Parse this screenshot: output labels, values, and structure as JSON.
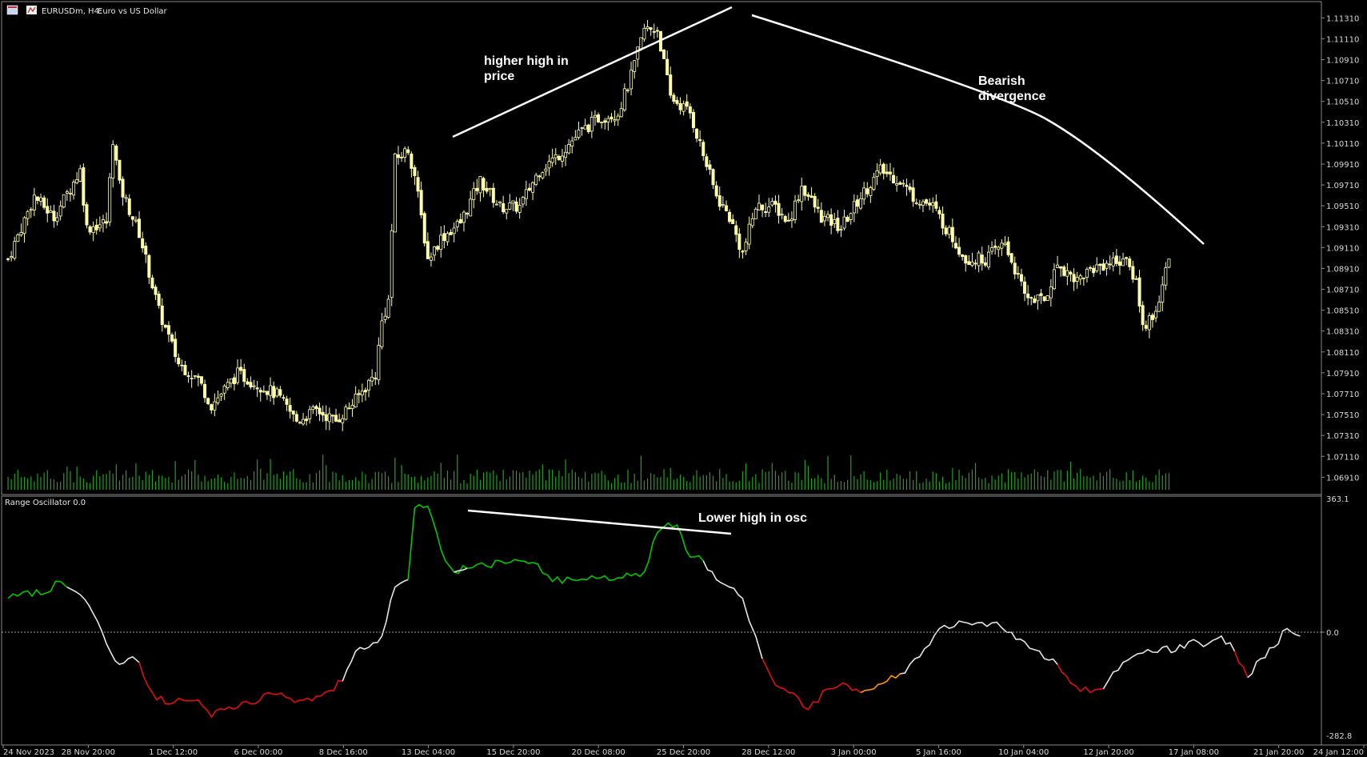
{
  "window": {
    "title_symbol": "EURUSDm, H4:",
    "title_desc": "Euro vs US Dollar",
    "icons": [
      "chart-window-icon",
      "indicator-icon"
    ]
  },
  "indicator": {
    "name": "Range Oscillator 0.0",
    "scale_top": "363.1",
    "scale_zero": "0.0",
    "scale_bottom": "-282.8"
  },
  "annotations": {
    "price_high": [
      "higher high in",
      "price"
    ],
    "bearish": [
      "Bearish",
      "divergence"
    ],
    "osc_high": "Lower high in osc"
  },
  "colors": {
    "background": "#000000",
    "candle": "#ffffaa",
    "volume": "#22a022",
    "osc_green": "#00c800",
    "osc_white": "#e6e6e6",
    "osc_red": "#e01010",
    "osc_orange": "#ff9900",
    "annotation": "#ffffff",
    "axis_text": "#d8d8d8"
  },
  "chart_data": [
    {
      "type": "candlestick",
      "title": "EURUSDm, H4: Euro vs US Dollar",
      "x_tick_labels": [
        "24 Nov 2023",
        "28 Nov 20:00",
        "1 Dec 12:00",
        "6 Dec 00:00",
        "8 Dec 16:00",
        "13 Dec 04:00",
        "15 Dec 20:00",
        "20 Dec 08:00",
        "25 Dec 20:00",
        "28 Dec 12:00",
        "3 Jan 00:00",
        "5 Jan 16:00",
        "10 Jan 04:00",
        "12 Jan 20:00",
        "17 Jan 08:00",
        "21 Jan 20:00",
        "24 Jan 12:00"
      ],
      "y_tick_labels": [
        "1.11310",
        "1.11110",
        "1.10910",
        "1.10710",
        "1.10510",
        "1.10310",
        "1.10110",
        "1.09910",
        "1.09710",
        "1.09510",
        "1.09310",
        "1.09110",
        "1.08910",
        "1.08710",
        "1.08510",
        "1.08310",
        "1.08110",
        "1.07910",
        "1.07710",
        "1.07510",
        "1.07310",
        "1.07110",
        "1.06910"
      ],
      "ylim": [
        1.0679,
        1.1142
      ],
      "close_path": [
        [
          0,
          1.09
        ],
        [
          8,
          1.096
        ],
        [
          14,
          1.094
        ],
        [
          22,
          1.0985
        ],
        [
          24,
          1.093
        ],
        [
          30,
          1.0935
        ],
        [
          32,
          1.1015
        ],
        [
          34,
          1.097
        ],
        [
          40,
          1.0925
        ],
        [
          46,
          1.085
        ],
        [
          52,
          1.08
        ],
        [
          58,
          1.0785
        ],
        [
          62,
          1.076
        ],
        [
          70,
          1.079
        ],
        [
          76,
          1.078
        ],
        [
          82,
          1.077
        ],
        [
          88,
          1.0745
        ],
        [
          94,
          1.0755
        ],
        [
          100,
          1.0745
        ],
        [
          106,
          1.0765
        ],
        [
          112,
          1.079
        ],
        [
          114,
          1.084
        ],
        [
          116,
          1.086
        ],
        [
          118,
          1.0995
        ],
        [
          122,
          1.1005
        ],
        [
          124,
          1.098
        ],
        [
          128,
          1.09
        ],
        [
          132,
          1.092
        ],
        [
          138,
          1.0935
        ],
        [
          144,
          1.0975
        ],
        [
          150,
          1.095
        ],
        [
          156,
          1.095
        ],
        [
          162,
          1.0985
        ],
        [
          168,
          1.1
        ],
        [
          174,
          1.102
        ],
        [
          180,
          1.1035
        ],
        [
          186,
          1.104
        ],
        [
          190,
          1.1075
        ],
        [
          194,
          1.112
        ],
        [
          198,
          1.112
        ],
        [
          202,
          1.1055
        ],
        [
          208,
          1.104
        ],
        [
          212,
          1.1
        ],
        [
          216,
          1.096
        ],
        [
          220,
          1.094
        ],
        [
          224,
          1.0905
        ],
        [
          228,
          1.095
        ],
        [
          234,
          1.095
        ],
        [
          238,
          1.0935
        ],
        [
          242,
          1.097
        ],
        [
          248,
          1.094
        ],
        [
          254,
          1.093
        ],
        [
          260,
          1.096
        ],
        [
          266,
          1.0985
        ],
        [
          272,
          1.0975
        ],
        [
          276,
          1.096
        ],
        [
          282,
          1.095
        ],
        [
          288,
          1.092
        ],
        [
          292,
          1.09
        ],
        [
          298,
          1.09
        ],
        [
          304,
          1.0915
        ],
        [
          310,
          1.0865
        ],
        [
          316,
          1.086
        ],
        [
          320,
          1.0895
        ],
        [
          326,
          1.088
        ],
        [
          330,
          1.089
        ],
        [
          334,
          1.0895
        ],
        [
          340,
          1.09
        ],
        [
          344,
          1.088
        ],
        [
          346,
          1.0835
        ],
        [
          350,
          1.085
        ],
        [
          354,
          1.09
        ]
      ]
    },
    {
      "type": "line",
      "title": "Range Oscillator 0.0",
      "ylim": [
        -282.8,
        363.1
      ],
      "y_tick_labels": [
        "363.1",
        "0.0",
        "-282.8"
      ],
      "segments": [
        {
          "color": "#00c800",
          "points": [
            [
              0,
              100
            ],
            [
              6,
              120
            ],
            [
              10,
              110
            ],
            [
              16,
              145
            ],
            [
              18,
              130
            ]
          ]
        },
        {
          "color": "#e6e6e6",
          "points": [
            [
              18,
              130
            ],
            [
              22,
              110
            ],
            [
              26,
              60
            ],
            [
              30,
              -20
            ],
            [
              34,
              -75
            ],
            [
              38,
              -55
            ],
            [
              40,
              -70
            ]
          ]
        },
        {
          "color": "#e01010",
          "points": [
            [
              40,
              -70
            ],
            [
              44,
              -150
            ],
            [
              48,
              -180
            ],
            [
              52,
              -165
            ],
            [
              58,
              -170
            ],
            [
              62,
              -215
            ],
            [
              66,
              -195
            ],
            [
              70,
              -190
            ],
            [
              74,
              -180
            ],
            [
              78,
              -155
            ],
            [
              82,
              -155
            ],
            [
              86,
              -165
            ],
            [
              90,
              -170
            ],
            [
              94,
              -160
            ],
            [
              98,
              -145
            ],
            [
              102,
              -120
            ]
          ]
        },
        {
          "color": "#e6e6e6",
          "points": [
            [
              102,
              -120
            ],
            [
              106,
              -40
            ],
            [
              110,
              -30
            ],
            [
              114,
              0
            ],
            [
              118,
              130
            ],
            [
              122,
              150
            ]
          ]
        },
        {
          "color": "#00c800",
          "points": [
            [
              122,
              150
            ],
            [
              124,
              340
            ],
            [
              128,
              345
            ],
            [
              132,
              230
            ],
            [
              136,
              170
            ],
            [
              140,
              180
            ]
          ]
        },
        {
          "color": "#e6e6e6",
          "points": [
            [
              136,
              170
            ],
            [
              140,
              180
            ]
          ]
        },
        {
          "color": "#00c800",
          "points": [
            [
              140,
              180
            ],
            [
              146,
              185
            ],
            [
              150,
              200
            ],
            [
              156,
              200
            ],
            [
              160,
              195
            ],
            [
              166,
              145
            ],
            [
              172,
              150
            ],
            [
              178,
              160
            ],
            [
              182,
              160
            ],
            [
              186,
              155
            ],
            [
              190,
              160
            ],
            [
              194,
              170
            ],
            [
              198,
              275
            ],
            [
              200,
              290
            ],
            [
              204,
              295
            ],
            [
              208,
              210
            ],
            [
              212,
              200
            ]
          ]
        },
        {
          "color": "#e6e6e6",
          "points": [
            [
              212,
              200
            ],
            [
              216,
              150
            ],
            [
              220,
              130
            ],
            [
              224,
              100
            ],
            [
              226,
              40
            ],
            [
              228,
              0
            ],
            [
              230,
              -60
            ]
          ]
        },
        {
          "color": "#e01010",
          "points": [
            [
              230,
              -60
            ],
            [
              234,
              -130
            ],
            [
              238,
              -150
            ],
            [
              244,
              -195
            ],
            [
              250,
              -140
            ],
            [
              256,
              -130
            ],
            [
              260,
              -150
            ]
          ]
        },
        {
          "color": "#ff9900",
          "points": [
            [
              260,
              -150
            ],
            [
              264,
              -140
            ],
            [
              268,
              -120
            ],
            [
              272,
              -100
            ]
          ]
        },
        {
          "color": "#e6e6e6",
          "points": [
            [
              272,
              -100
            ],
            [
              278,
              -55
            ],
            [
              284,
              20
            ],
            [
              290,
              40
            ],
            [
              294,
              30
            ],
            [
              300,
              35
            ],
            [
              306,
              10
            ],
            [
              310,
              -15
            ],
            [
              316,
              -60
            ],
            [
              320,
              -75
            ]
          ]
        },
        {
          "color": "#e01010",
          "points": [
            [
              320,
              -75
            ],
            [
              324,
              -125
            ],
            [
              330,
              -150
            ],
            [
              334,
              -140
            ]
          ]
        },
        {
          "color": "#e6e6e6",
          "points": [
            [
              334,
              -140
            ],
            [
              340,
              -70
            ],
            [
              346,
              -45
            ],
            [
              352,
              -30
            ],
            [
              356,
              -40
            ],
            [
              360,
              -15
            ],
            [
              366,
              -20
            ],
            [
              370,
              0
            ],
            [
              374,
              -40
            ]
          ]
        },
        {
          "color": "#e01010",
          "points": [
            [
              374,
              -40
            ],
            [
              378,
              -110
            ]
          ]
        },
        {
          "color": "#e6e6e6",
          "points": [
            [
              378,
              -110
            ],
            [
              382,
              -60
            ],
            [
              386,
              -30
            ],
            [
              390,
              20
            ],
            [
              394,
              0
            ]
          ]
        }
      ]
    }
  ]
}
